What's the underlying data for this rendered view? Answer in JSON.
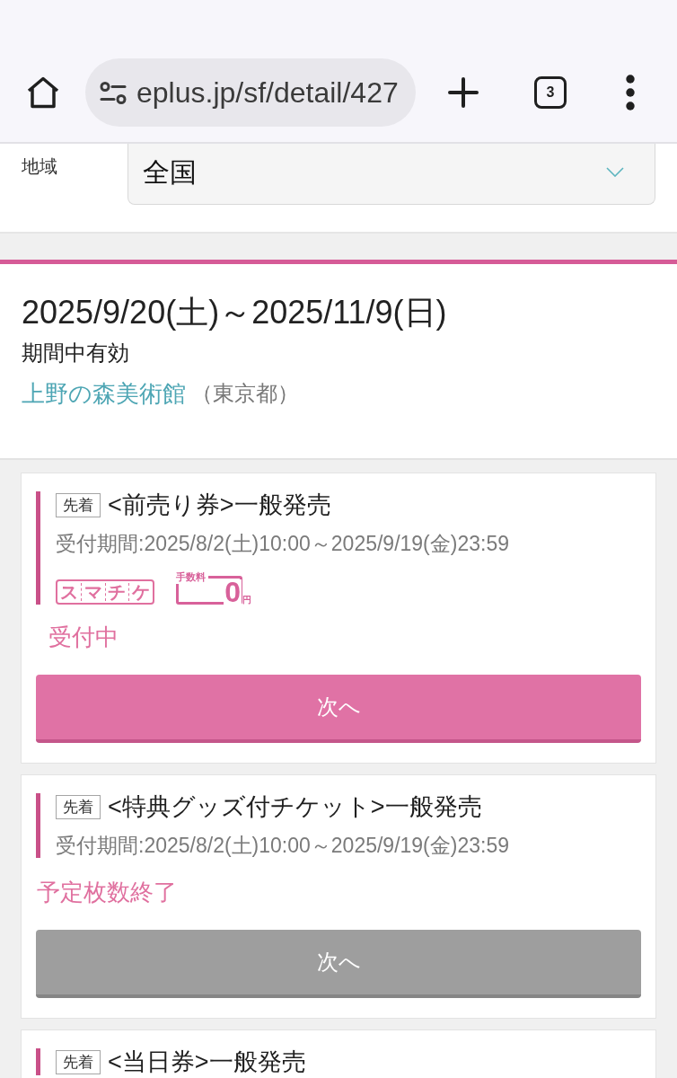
{
  "browser": {
    "url": "eplus.jp/sf/detail/427",
    "tab_count": "3"
  },
  "region_filter": {
    "label": "地域",
    "value": "全国"
  },
  "event": {
    "dates": "2025/9/20(土)～2025/11/9(日)",
    "validity": "期間中有効",
    "venue": "上野の森美術館",
    "prefecture": "（東京都）"
  },
  "tickets": [
    {
      "badge": "先着",
      "title": "<前売り券>一般発売",
      "period": "受付期間:2025/8/2(土)10:00～2025/9/19(金)23:59",
      "tags": [
        {
          "kind": "smart_ticket",
          "text": "スマチケ"
        },
        {
          "kind": "fee",
          "label": "手数料",
          "amount": "0",
          "unit": "円"
        }
      ],
      "status": "受付中",
      "button": {
        "label": "次へ",
        "disabled": false
      }
    },
    {
      "badge": "先着",
      "title": "<特典グッズ付チケット>一般発売",
      "period": "受付期間:2025/8/2(土)10:00～2025/9/19(金)23:59",
      "status": "予定枚数終了",
      "button": {
        "label": "次へ",
        "disabled": true
      }
    },
    {
      "badge": "先着",
      "title": "<当日券>一般発売"
    }
  ]
}
